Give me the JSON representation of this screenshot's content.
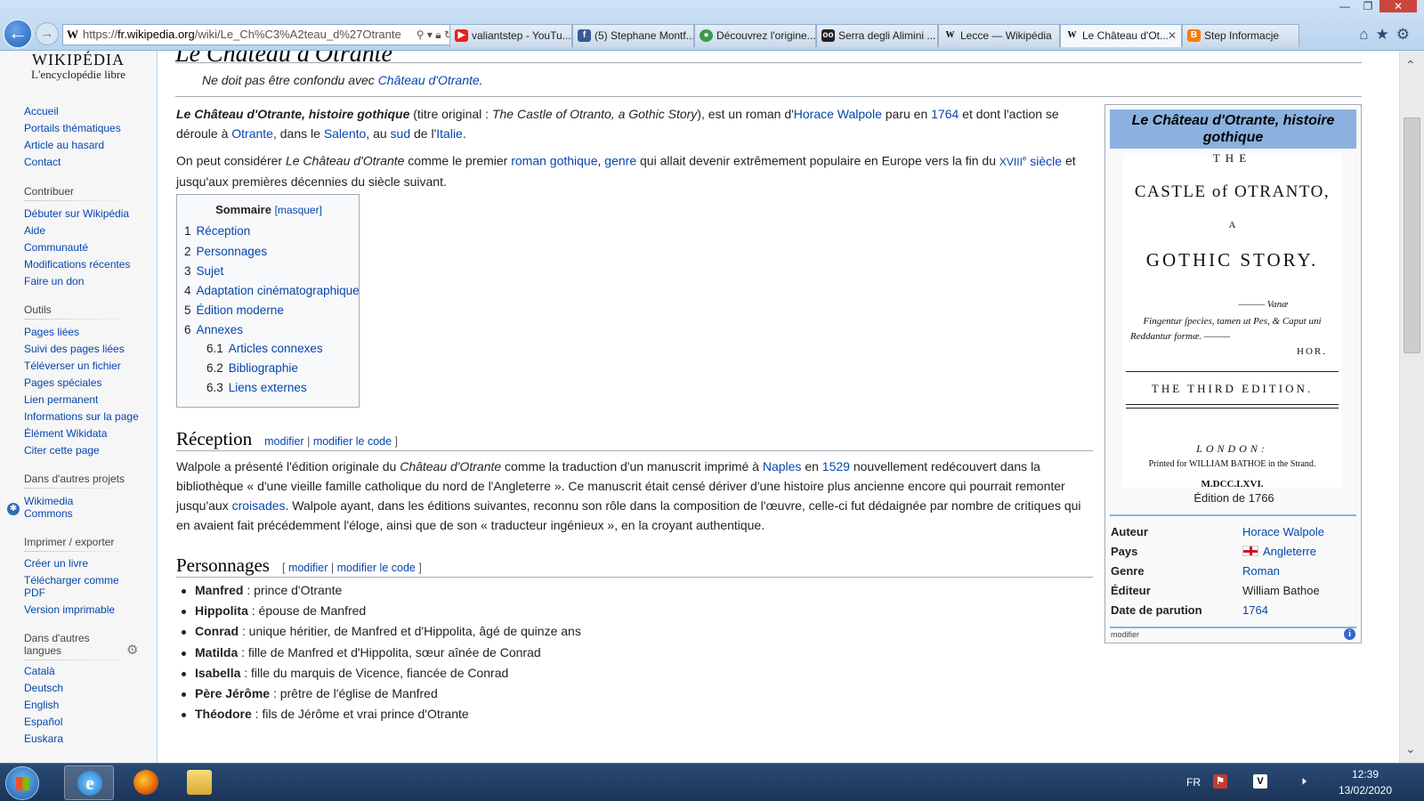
{
  "browser": {
    "address": {
      "protocol": "https://",
      "host": "fr.wikipedia.org",
      "path": "/wiki/Le_Ch%C3%A2teau_d%27Otrante"
    },
    "tabs": [
      {
        "label": "valiantstep - YouTu...",
        "icon": "youtube-icon",
        "color": "#e62117"
      },
      {
        "label": "(5) Stephane Montf...",
        "icon": "facebook-icon",
        "color": "#3b5998"
      },
      {
        "label": "Découvrez l'origine...",
        "icon": "globe-icon",
        "color": "#3a9b4a"
      },
      {
        "label": "Serra degli Alimini ...",
        "icon": "tripadvisor-icon",
        "color": "#222222"
      },
      {
        "label": "Lecce — Wikipédia",
        "icon": "wikipedia-icon",
        "color": "#ffffff"
      },
      {
        "label": "Le Château d'Ot...",
        "icon": "wikipedia-icon",
        "color": "#ffffff"
      },
      {
        "label": "Step Informacje",
        "icon": "blogger-icon",
        "color": "#f57d00"
      }
    ]
  },
  "sidebar": {
    "logo_line1": "WIKIPÉDIA",
    "logo_line2": "L'encyclopédie libre",
    "nav": [
      "Accueil",
      "Portails thématiques",
      "Article au hasard",
      "Contact"
    ],
    "contribuer_title": "Contribuer",
    "contribuer": [
      "Débuter sur Wikipédia",
      "Aide",
      "Communauté",
      "Modifications récentes",
      "Faire un don"
    ],
    "outils_title": "Outils",
    "outils": [
      "Pages liées",
      "Suivi des pages liées",
      "Téléverser un fichier",
      "Pages spéciales",
      "Lien permanent",
      "Informations sur la page",
      "Élément Wikidata",
      "Citer cette page"
    ],
    "projets_title": "Dans d'autres projets",
    "projets": [
      "Wikimedia Commons"
    ],
    "imprimer_title": "Imprimer / exporter",
    "imprimer": [
      "Créer un livre",
      "Télécharger comme PDF",
      "Version imprimable"
    ],
    "langues_title": "Dans d'autres langues",
    "langues": [
      "Català",
      "Deutsch",
      "English",
      "Español",
      "Euskara"
    ]
  },
  "article": {
    "title": "Le Château d'Otrante",
    "hatnote_prefix": "Ne doit pas être confondu avec ",
    "hatnote_link": "Château d'Otrante",
    "hatnote_suffix": ".",
    "intro1": {
      "bold": "Le Château d'Otrante, histoire gothique",
      "t1": " (titre original : ",
      "orig": "The Castle of Otranto, a Gothic Story",
      "t2": "), est un roman d'",
      "l1": "Horace Walpole",
      "t3": " paru en ",
      "l2": "1764",
      "t4": " et dont l'action se déroule à ",
      "l3": "Otrante",
      "t5": ", dans le ",
      "l4": "Salento",
      "t6": ", au ",
      "l5": "sud",
      "t7": " de l'",
      "l6": "Italie",
      "t8": "."
    },
    "intro2": {
      "t1": "On peut considérer ",
      "it": "Le Château d'Otrante",
      "t2": " comme le premier ",
      "l1": "roman gothique",
      "t3": ", ",
      "l2": "genre",
      "t4": " qui allait devenir extrêmement populaire en Europe vers la fin du ",
      "l3a": "XVIII",
      "l3b": "e",
      "l3c": " siècle",
      "t5": " et jusqu'aux premières décennies du siècle suivant."
    },
    "toc": {
      "title": "Sommaire",
      "toggle": "[masquer]",
      "items": [
        {
          "num": "1",
          "label": "Réception"
        },
        {
          "num": "2",
          "label": "Personnages"
        },
        {
          "num": "3",
          "label": "Sujet"
        },
        {
          "num": "4",
          "label": "Adaptation cinématographique"
        },
        {
          "num": "5",
          "label": "Édition moderne"
        },
        {
          "num": "6",
          "label": "Annexes"
        },
        {
          "num": "6.1",
          "label": "Articles connexes"
        },
        {
          "num": "6.2",
          "label": "Bibliographie"
        },
        {
          "num": "6.3",
          "label": "Liens externes"
        }
      ]
    },
    "edit": {
      "open": "[ ",
      "modifier": "modifier",
      "sep": " | ",
      "modifier_code": "modifier le code",
      "close": " ]"
    },
    "reception": {
      "heading": "Réception",
      "t1": "Walpole a présenté l'édition originale du ",
      "it": "Château d'Otrante",
      "t2": " comme la traduction d'un manuscrit imprimé à ",
      "l1": "Naples",
      "t3": " en ",
      "l2": "1529",
      "t4": " nouvellement redécouvert dans la bibliothèque « d'une vieille famille catholique du nord de l'Angleterre ». Ce manuscrit était censé dériver d'une histoire plus ancienne encore qui pourrait remonter jusqu'aux ",
      "l3": "croisades",
      "t5": ". Walpole ayant, dans les éditions suivantes, reconnu son rôle dans la composition de l'œuvre, celle-ci fut dédaignée par nombre de critiques qui en avaient fait précédemment l'éloge, ainsi que de son « traducteur ingénieux », en la croyant authentique."
    },
    "personnages": {
      "heading": "Personnages",
      "items": [
        {
          "name": "Manfred",
          "desc": " : prince d'Otrante"
        },
        {
          "name": "Hippolita",
          "desc": " : épouse de Manfred"
        },
        {
          "name": "Conrad",
          "desc": " : unique héritier, de Manfred et d'Hippolita, âgé de quinze ans"
        },
        {
          "name": "Matilda",
          "desc": " : fille de Manfred et d'Hippolita, sœur aînée de Conrad"
        },
        {
          "name": "Isabella",
          "desc": " : fille du marquis de Vicence, fiancée de Conrad"
        },
        {
          "name": "Père Jérôme",
          "desc": " : prêtre de l'église de Manfred"
        },
        {
          "name": "Théodore",
          "desc": " : fils de Jérôme et vrai prince d'Otrante"
        }
      ]
    }
  },
  "infobox": {
    "title": "Le Château d'Otrante, histoire gothique",
    "book": {
      "the": "THE",
      "castle": "CASTLE of OTRANTO,",
      "a": "A",
      "gothic": "GOTHIC STORY.",
      "vanae": "——— Vanæ",
      "latin1": "Fingentur ſpecies, tamen ut Pes, & Caput uni",
      "latin2": "Reddantur formæ. ———",
      "hor": "HOR.",
      "edition": "THE THIRD EDITION.",
      "london": "LONDON:",
      "printed": "Printed for WILLIAM BATHOE in the Strand.",
      "year": "M.DCC.LXVI."
    },
    "caption": "Édition de 1766",
    "rows": [
      {
        "label": "Auteur",
        "value": "Horace Walpole",
        "link": true
      },
      {
        "label": "Pays",
        "value": "Angleterre",
        "link": true
      },
      {
        "label": "Genre",
        "value": "Roman",
        "link": true
      },
      {
        "label": "Éditeur",
        "value": "William Bathoe",
        "link": false
      },
      {
        "label": "Date de parution",
        "value": "1764",
        "link": true
      }
    ],
    "modifier": "modifier"
  },
  "taskbar": {
    "lang": "FR",
    "time": "12:39",
    "date": "13/02/2020"
  }
}
